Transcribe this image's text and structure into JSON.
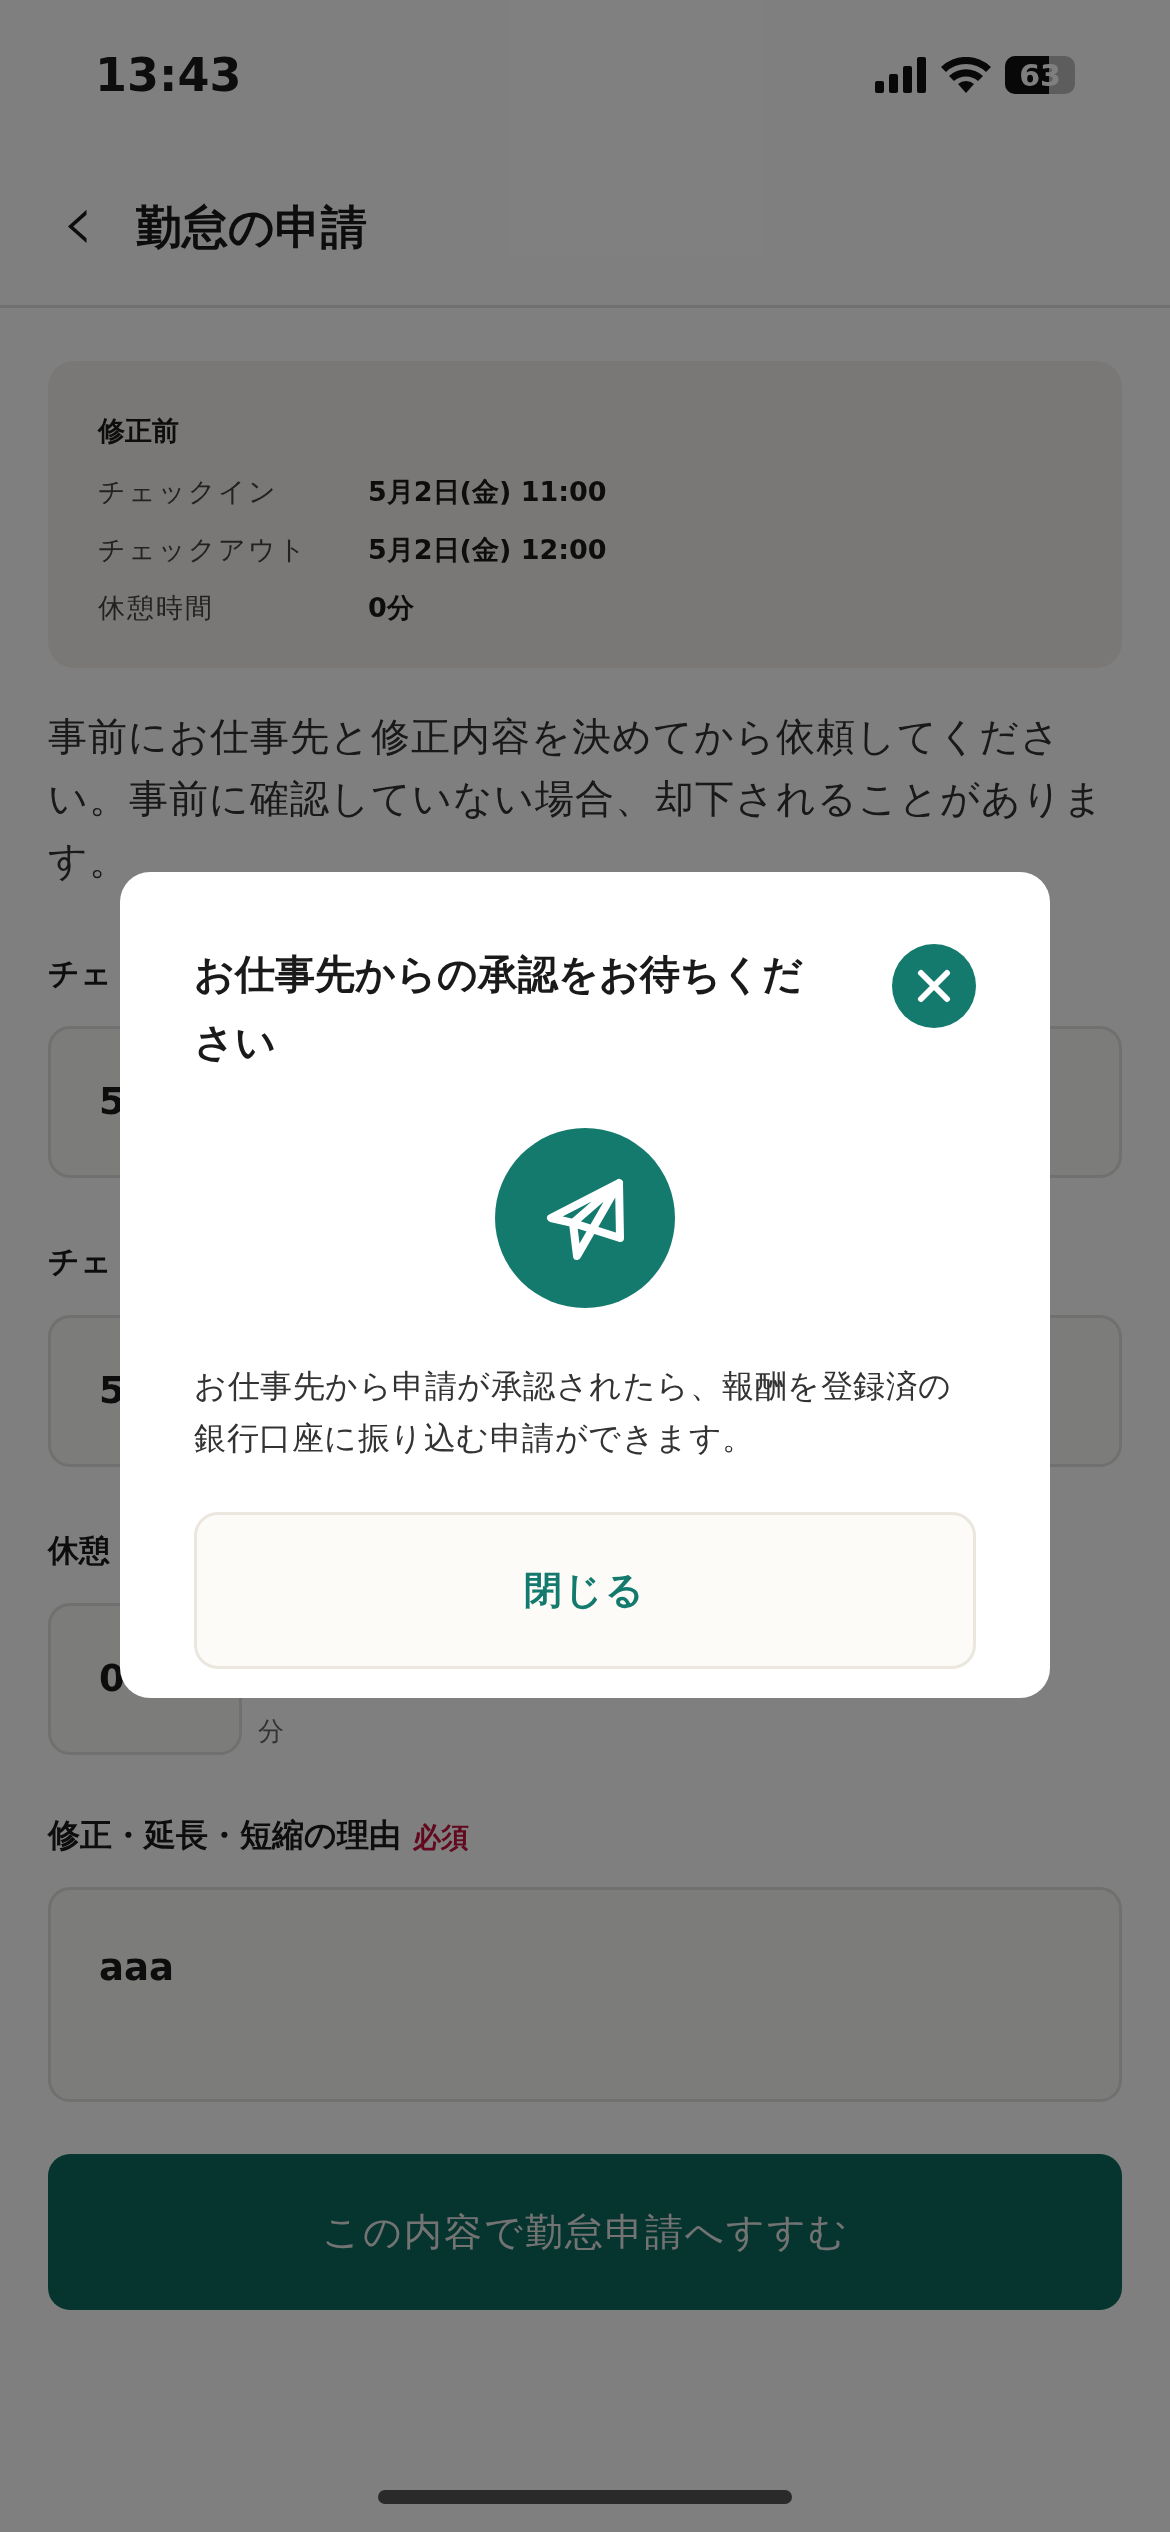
{
  "status_bar": {
    "time": "13:43",
    "battery": "63"
  },
  "header": {
    "back": "‹",
    "title": "勤怠の申請"
  },
  "before_card": {
    "title": "修正前",
    "rows": [
      {
        "label": "チェックイン",
        "value": "5月2日(金) 11:00"
      },
      {
        "label": "チェックアウト",
        "value": "5月2日(金) 12:00"
      },
      {
        "label": "休憩時間",
        "value": "0分"
      }
    ]
  },
  "notice": "事前にお仕事先と修正内容を決めてから依頼してください。事前に確認していない場合、却下されることがあります。",
  "fields": [
    {
      "label": "チェ",
      "value": "5"
    },
    {
      "label": "チェ",
      "value": "5"
    },
    {
      "label": "休憩",
      "value": "0",
      "unit": "分"
    }
  ],
  "reason": {
    "label": "修正・延長・短縮の理由",
    "required": "必須",
    "value": "aaa"
  },
  "submit_button": {
    "label": "この内容で勤怠申請へすすむ",
    "disabled": true
  },
  "dialog": {
    "title": "お仕事先からの承認をお待ちください",
    "message": "お仕事先から申請が承認されたら、報酬を登録済の銀行口座に振り込む申請ができます。",
    "close_button": "閉じる"
  }
}
